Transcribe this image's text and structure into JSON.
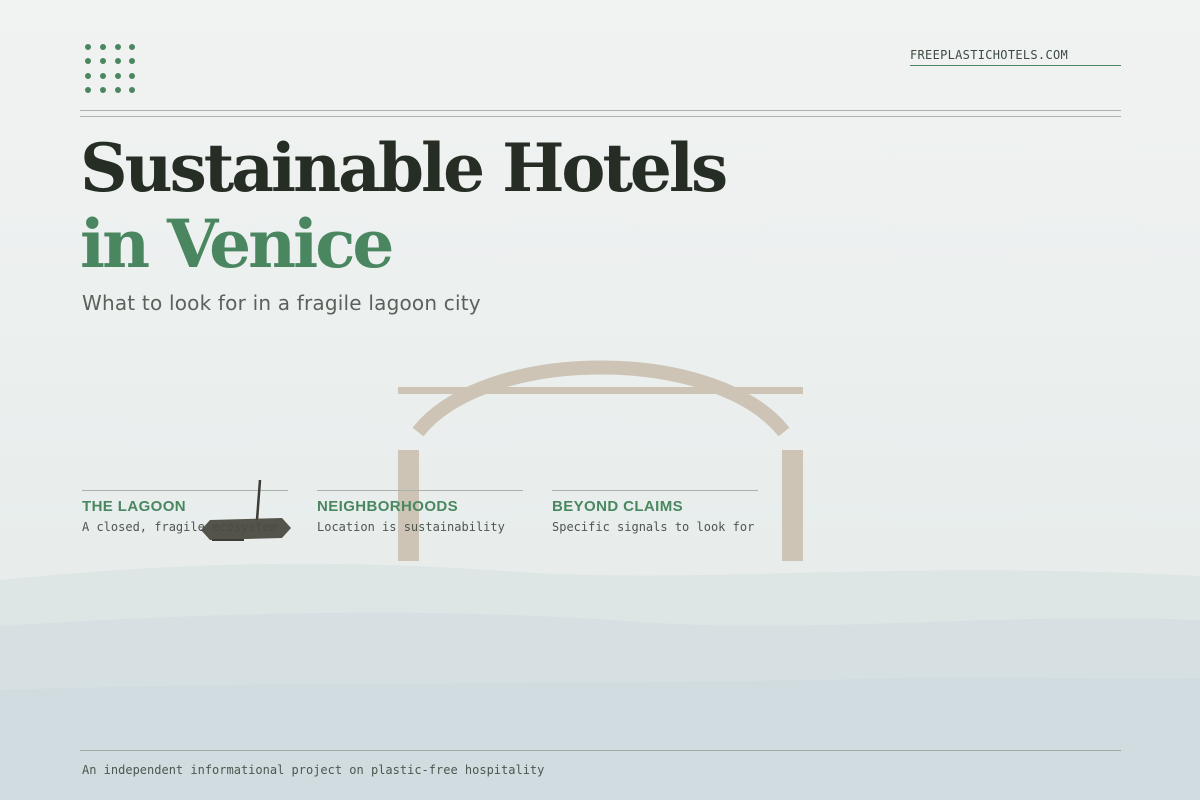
{
  "header": {
    "logo_icon": "dot-grid-logo-icon",
    "site_link": "FREEPLASTICHOTELS.COM"
  },
  "hero": {
    "title_line1": "Sustainable Hotels",
    "title_line2": "in Venice",
    "subtitle": "What to look for in a fragile lagoon city"
  },
  "illustration": {
    "bridge_icon": "arch-bridge-icon",
    "boat_icon": "gondola-boat-icon",
    "water_icon": "lagoon-waves-icon"
  },
  "sections": [
    {
      "title": "THE LAGOON",
      "description": "A closed, fragile ecosystem"
    },
    {
      "title": "NEIGHBORHOODS",
      "description": "Location is sustainability"
    },
    {
      "title": "BEYOND CLAIMS",
      "description": "Specific signals to look for"
    }
  ],
  "footer": {
    "text": "An independent informational project on plastic-free hospitality"
  },
  "colors": {
    "accent_green": "#4a8760",
    "title_dark": "#252d25",
    "bridge_beige": "#cdc4b5",
    "water": "#d3dfe1",
    "background": "#eef1f0"
  }
}
